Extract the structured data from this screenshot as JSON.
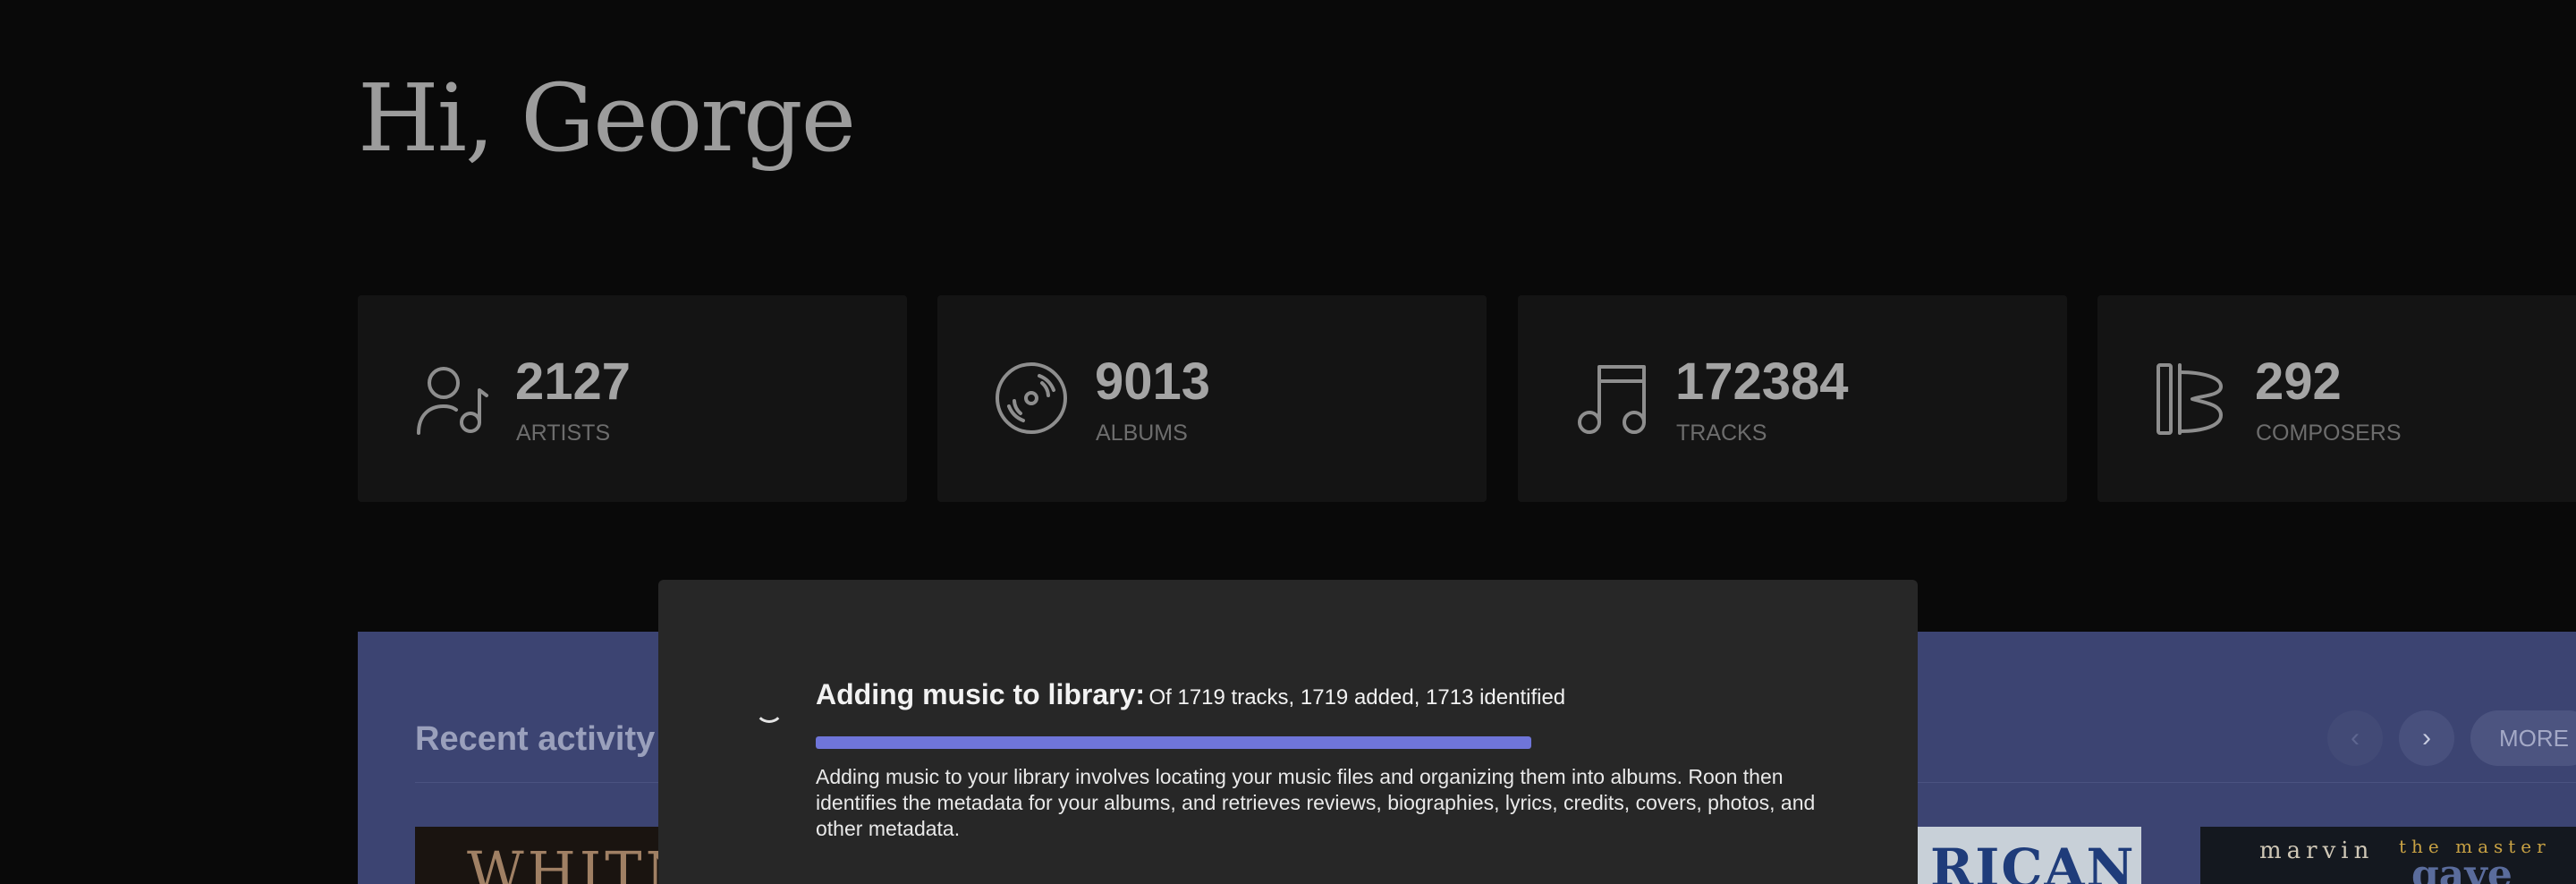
{
  "greeting": "Hi, George",
  "stats": [
    {
      "icon": "artist-icon",
      "value": "2127",
      "label": "ARTISTS"
    },
    {
      "icon": "album-disc-icon",
      "value": "9013",
      "label": "ALBUMS"
    },
    {
      "icon": "music-note-icon",
      "value": "172384",
      "label": "TRACKS"
    },
    {
      "icon": "composer-icon",
      "value": "292",
      "label": "COMPOSERS"
    }
  ],
  "recent": {
    "title": "Recent activity",
    "more_label": "MORE",
    "prev_icon": "chevron-left-icon",
    "next_icon": "chevron-right-icon",
    "prev_glyph": "‹",
    "next_glyph": "›",
    "thumbnails": [
      {
        "text": "WHITN"
      },
      {
        "text": "RICAN"
      },
      {
        "line1": "marvin",
        "line2": "the master",
        "line3": "gaye"
      }
    ]
  },
  "import_modal": {
    "title": "Adding music to library:",
    "status": "Of 1719 tracks, 1719 added, 1713 identified",
    "progress_percent": 100,
    "description": "Adding music to your library involves locating your music files and organizing them into albums. Roon then identifies the metadata for your albums, and retrieves reviews, biographies, lyrics, credits, covers, photos, and other metadata."
  },
  "colors": {
    "background": "#090909",
    "card": "#141414",
    "recent_panel": "#3c4472",
    "modal": "#272727",
    "progress": "#6f75d9"
  }
}
